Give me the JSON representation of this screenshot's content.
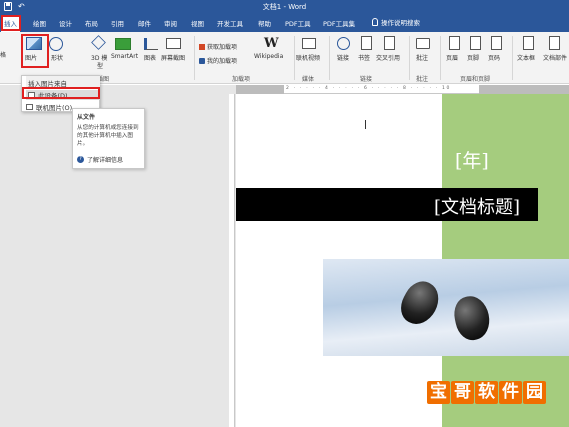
{
  "window": {
    "title": "文档1 - Word"
  },
  "tabs": [
    {
      "label": "插入",
      "active": true
    },
    {
      "label": "绘图"
    },
    {
      "label": "设计"
    },
    {
      "label": "布局"
    },
    {
      "label": "引用"
    },
    {
      "label": "邮件"
    },
    {
      "label": "审阅"
    },
    {
      "label": "视图"
    },
    {
      "label": "开发工具"
    },
    {
      "label": "帮助"
    },
    {
      "label": "PDF工具"
    },
    {
      "label": "PDF工具集"
    }
  ],
  "tell_me": "操作说明搜索",
  "ribbon": {
    "items": {
      "pictures": "图片",
      "shapes": "形状",
      "models_3d_line1": "3D 模",
      "models_3d_line2": "型",
      "smartart": "SmartArt",
      "chart": "图表",
      "screenshot": "屏幕截图",
      "get_addins": "获取加载项",
      "my_addins": "我的加载项",
      "wikipedia": "Wikipedia",
      "wiki_glyph": "W",
      "online_video": "联机视频",
      "link": "链接",
      "bookmark": "书签",
      "cross_ref": "交叉引用",
      "comment": "批注",
      "header": "页眉",
      "footer": "页脚",
      "page_number": "页码",
      "textbox": "文本框",
      "quickparts": "文档部件",
      "left_cut": "格"
    },
    "groups": {
      "illustrations": "插图",
      "addins": "加载项",
      "media": "媒体",
      "links": "链接",
      "comments": "批注",
      "header_footer": "页眉和页脚"
    }
  },
  "dropdown": {
    "header": "插入图片来自",
    "items": [
      "此设备(D)...",
      "联机图片(O)..."
    ]
  },
  "tooltip": {
    "title": "从文件",
    "body": "从您的计算机或您连接到的其他计算机中插入图片。",
    "link": "了解详细信息"
  },
  "ruler_ticks": "2 · · · · · 4 · · · · · 6 · · · · · 8 · · · · · 10",
  "document": {
    "year": "[年]",
    "doc_title": "[文档标题]"
  },
  "watermark": [
    "宝",
    "哥",
    "软",
    "件",
    "园"
  ],
  "colors": {
    "accent": "#2b579a",
    "highlight": "#e02020",
    "green": "#a5cc7e",
    "watermark": "#f06e00"
  }
}
